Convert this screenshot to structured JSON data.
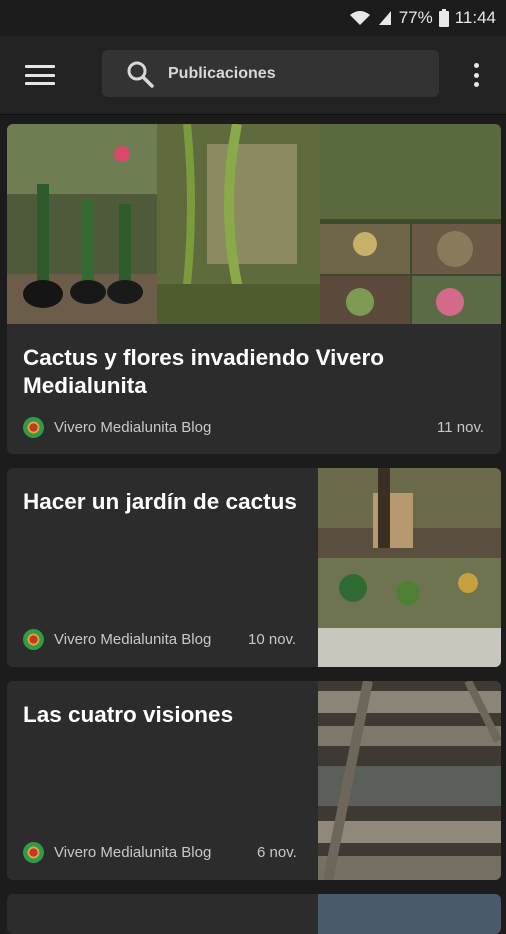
{
  "status": {
    "battery": "77%",
    "time": "11:44"
  },
  "search": {
    "placeholder": "Publicaciones"
  },
  "posts": [
    {
      "title": "Cactus y flores invadiendo Vivero Medialunita",
      "blog": "Vivero Medialunita Blog",
      "date": "11 nov."
    },
    {
      "title": "Hacer un jardín de cactus",
      "blog": "Vivero Medialunita Blog",
      "date": "10 nov."
    },
    {
      "title": "Las cuatro visiones",
      "blog": "Vivero Medialunita Blog",
      "date": "6 nov."
    }
  ],
  "colors": {
    "background": "#1c1c1c",
    "appbar": "#222222",
    "card": "#2c2c2c",
    "search": "#333333"
  }
}
